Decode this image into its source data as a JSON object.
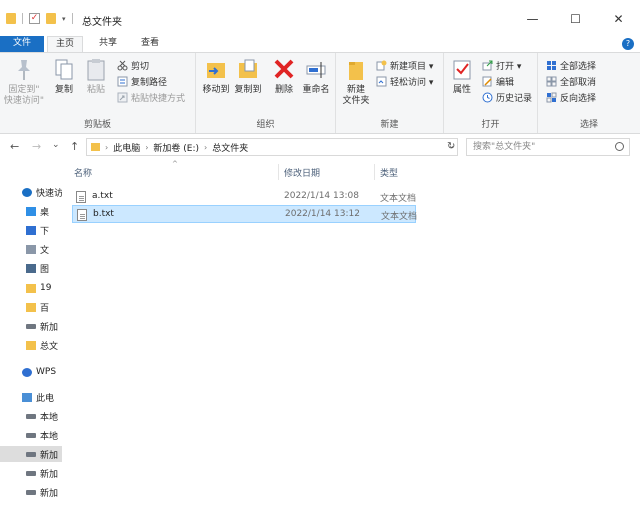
{
  "window": {
    "title": "总文件夹",
    "controls": {
      "minimize": "—",
      "maximize": "☐",
      "close": "✕"
    }
  },
  "ribbon_tabs": [
    "文件",
    "主页",
    "共享",
    "查看"
  ],
  "help": "?",
  "ribbon": {
    "clipboard": {
      "label": "剪贴板",
      "pin": "固定到\"\n快速访问\"",
      "copy": "复制",
      "paste": "粘贴",
      "cut": "剪切",
      "copy_path": "复制路径",
      "paste_shortcut": "粘贴快捷方式"
    },
    "organize": {
      "label": "组织",
      "move_to": "移动到",
      "copy_to": "复制到",
      "delete": "删除",
      "rename": "重命名"
    },
    "new": {
      "label": "新建",
      "new_folder": "新建\n文件夹",
      "new_item": "新建项目 ▾",
      "easy_access": "轻松访问 ▾"
    },
    "open": {
      "label": "打开",
      "properties": "属性",
      "open": "打开 ▾",
      "edit": "编辑",
      "history": "历史记录"
    },
    "select": {
      "label": "选择",
      "select_all": "全部选择",
      "select_none": "全部取消",
      "invert": "反向选择"
    }
  },
  "address": {
    "back": "←",
    "forward": "→",
    "recent": "⌄",
    "up": "↑",
    "crumbs": [
      "此电脑",
      "新加卷 (E:)",
      "总文件夹"
    ],
    "dropdown": "⌄",
    "refresh": "↻",
    "search_placeholder": "搜索\"总文件夹\""
  },
  "navpane": [
    {
      "label": "快速访",
      "icon": "star-icon",
      "color": "#1a6fc4"
    },
    {
      "label": "桌",
      "icon": "desktop-icon",
      "color": "#2f8fe6"
    },
    {
      "label": "下",
      "icon": "download-icon",
      "color": "#2f6fd1"
    },
    {
      "label": "文",
      "icon": "document-icon",
      "color": "#8a97a8"
    },
    {
      "label": "图",
      "icon": "picture-icon",
      "color": "#4a6a8c"
    },
    {
      "label": "19",
      "icon": "folder-icon",
      "color": "#f3c14b"
    },
    {
      "label": "百",
      "icon": "folder-icon",
      "color": "#f3c14b"
    },
    {
      "label": "新加",
      "icon": "drive-icon",
      "color": "#6f7680"
    },
    {
      "label": "总文",
      "icon": "folder-icon",
      "color": "#f3c14b"
    },
    {
      "label": "WPS",
      "icon": "cloud-icon",
      "color": "#2f6fd1"
    },
    {
      "label": "此电",
      "icon": "computer-icon",
      "color": "#4a8fd6"
    },
    {
      "label": "本地",
      "icon": "drive-icon",
      "color": "#6f7680"
    },
    {
      "label": "本地",
      "icon": "drive-icon",
      "color": "#6f7680"
    },
    {
      "label": "新加",
      "icon": "drive-icon",
      "color": "#6f7680",
      "selected": true
    },
    {
      "label": "新加",
      "icon": "drive-icon",
      "color": "#6f7680"
    },
    {
      "label": "新加",
      "icon": "drive-icon",
      "color": "#6f7680"
    }
  ],
  "columns": {
    "name": "名称",
    "date": "修改日期",
    "type": "类型"
  },
  "files": [
    {
      "name": "a.txt",
      "date": "2022/1/14 13:08",
      "type": "文本文档",
      "selected": false
    },
    {
      "name": "b.txt",
      "date": "2022/1/14 13:12",
      "type": "文本文档",
      "selected": true
    }
  ],
  "colors": {
    "accent": "#1a6fc4",
    "selection": "#cce8ff",
    "selection_border": "#99d1ff"
  }
}
